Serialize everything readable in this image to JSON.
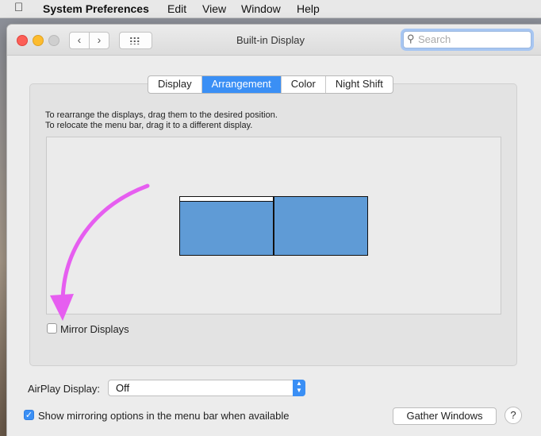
{
  "menubar": {
    "apple_icon": "apple-icon",
    "app_name": "System Preferences",
    "items": [
      "Edit",
      "View",
      "Window",
      "Help"
    ]
  },
  "window": {
    "title": "Built-in Display",
    "search_placeholder": "Search",
    "back_glyph": "‹",
    "forward_glyph": "›"
  },
  "tabs": [
    {
      "label": "Display",
      "active": false
    },
    {
      "label": "Arrangement",
      "active": true
    },
    {
      "label": "Color",
      "active": false
    },
    {
      "label": "Night Shift",
      "active": false
    }
  ],
  "arrangement": {
    "instruction_1": "To rearrange the displays, drag them to the desired position.",
    "instruction_2": "To relocate the menu bar, drag it to a different display.",
    "display_color": "#5f9bd6",
    "mirror_label": "Mirror Displays",
    "mirror_checked": false,
    "annotation_color": "#e65ef0"
  },
  "footer": {
    "airplay_label": "AirPlay Display:",
    "airplay_value": "Off",
    "show_mirroring_label": "Show mirroring options in the menu bar when available",
    "show_mirroring_checked": true,
    "gather_button": "Gather Windows",
    "help_glyph": "?"
  },
  "colors": {
    "accent": "#3a8ff5"
  }
}
